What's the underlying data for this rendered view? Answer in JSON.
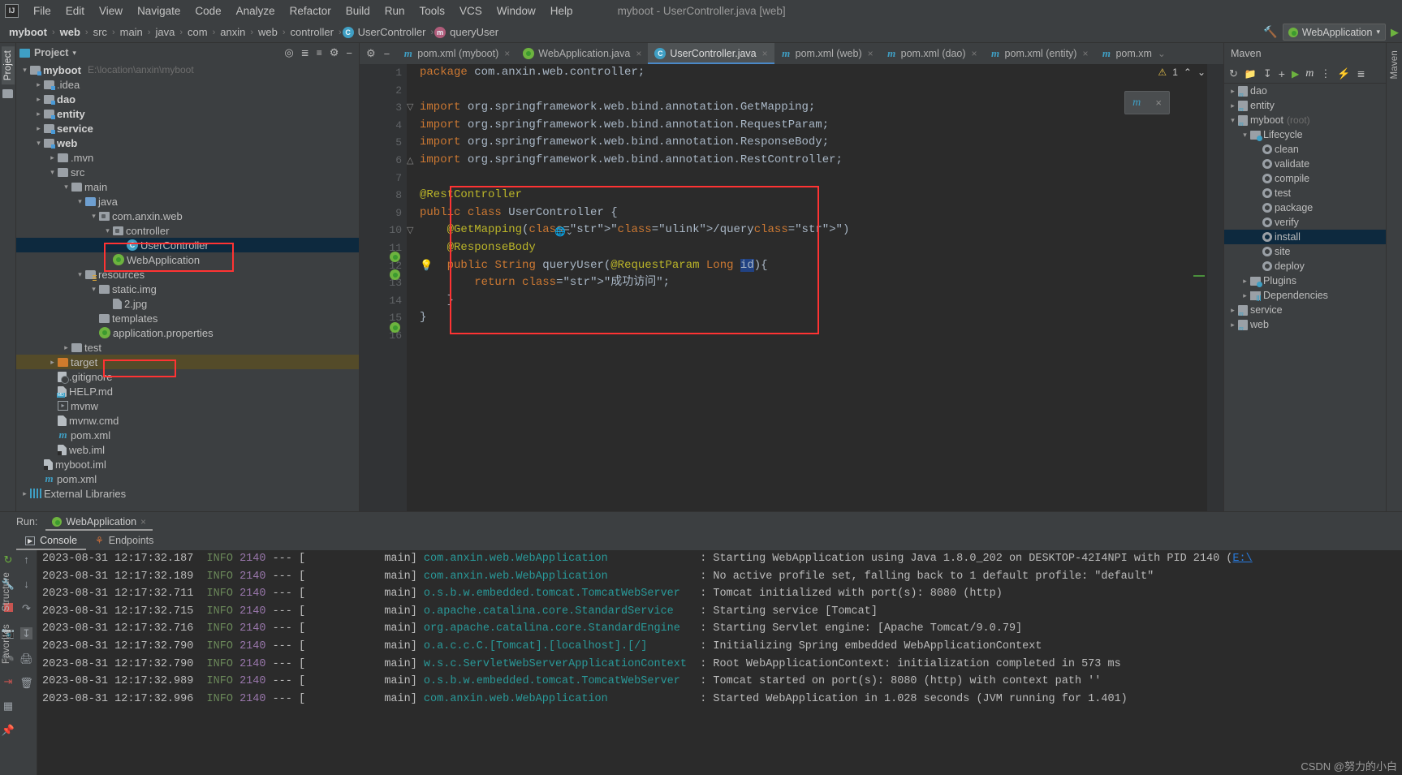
{
  "window": {
    "title": "myboot - UserController.java [web]",
    "logo": "IJ"
  },
  "menu": {
    "items": [
      "File",
      "Edit",
      "View",
      "Navigate",
      "Code",
      "Analyze",
      "Refactor",
      "Build",
      "Run",
      "Tools",
      "VCS",
      "Window",
      "Help"
    ]
  },
  "breadcrumb": {
    "items": [
      {
        "label": "myboot",
        "bold": true
      },
      {
        "label": "web",
        "bold": true
      },
      {
        "label": "src",
        "bold": false
      },
      {
        "label": "main",
        "bold": false
      },
      {
        "label": "java",
        "bold": false
      },
      {
        "label": "com",
        "bold": false
      },
      {
        "label": "anxin",
        "bold": false
      },
      {
        "label": "web",
        "bold": false
      },
      {
        "label": "controller",
        "bold": false
      },
      {
        "label": "UserController",
        "bold": false,
        "icon": "class-icon"
      },
      {
        "label": "queryUser",
        "bold": false,
        "icon": "method-icon"
      }
    ],
    "separator": "›"
  },
  "toolbar_right": {
    "run_config": "WebApplication",
    "dropdown_caret": "▾"
  },
  "project_panel": {
    "title": "Project",
    "caret": "▾",
    "tool_icons": [
      "locate-icon",
      "expand-all-icon",
      "collapse-all-icon",
      "gear-icon",
      "hide-icon"
    ],
    "tree": [
      {
        "label": "myboot",
        "path": "E:\\location\\anxin\\myboot",
        "depth": 0,
        "arrow": "open",
        "icon": "module-folder",
        "bold": true
      },
      {
        "label": ".idea",
        "depth": 1,
        "arrow": "closed",
        "icon": "module-folder"
      },
      {
        "label": "dao",
        "depth": 1,
        "arrow": "closed",
        "icon": "module-folder",
        "bold": true
      },
      {
        "label": "entity",
        "depth": 1,
        "arrow": "closed",
        "icon": "module-folder",
        "bold": true
      },
      {
        "label": "service",
        "depth": 1,
        "arrow": "closed",
        "icon": "module-folder",
        "bold": true
      },
      {
        "label": "web",
        "depth": 1,
        "arrow": "open",
        "icon": "module-folder",
        "bold": true
      },
      {
        "label": ".mvn",
        "depth": 2,
        "arrow": "closed",
        "icon": "folder"
      },
      {
        "label": "src",
        "depth": 2,
        "arrow": "open",
        "icon": "folder"
      },
      {
        "label": "main",
        "depth": 3,
        "arrow": "open",
        "icon": "folder"
      },
      {
        "label": "java",
        "depth": 4,
        "arrow": "open",
        "icon": "source-folder"
      },
      {
        "label": "com.anxin.web",
        "depth": 5,
        "arrow": "open",
        "icon": "package"
      },
      {
        "label": "controller",
        "depth": 6,
        "arrow": "open",
        "icon": "package"
      },
      {
        "label": "UserController",
        "depth": 7,
        "arrow": "none",
        "icon": "class",
        "selected": true
      },
      {
        "label": "WebApplication",
        "depth": 6,
        "arrow": "none",
        "icon": "spring-class"
      },
      {
        "label": "resources",
        "depth": 4,
        "arrow": "open",
        "icon": "resource-folder"
      },
      {
        "label": "static.img",
        "depth": 5,
        "arrow": "open",
        "icon": "folder"
      },
      {
        "label": "2.jpg",
        "depth": 6,
        "arrow": "none",
        "icon": "image-file"
      },
      {
        "label": "templates",
        "depth": 5,
        "arrow": "none",
        "icon": "folder"
      },
      {
        "label": "application.properties",
        "depth": 5,
        "arrow": "none",
        "icon": "spring-properties"
      },
      {
        "label": "test",
        "depth": 3,
        "arrow": "closed",
        "icon": "folder"
      },
      {
        "label": "target",
        "depth": 2,
        "arrow": "closed",
        "icon": "excluded-folder",
        "highlight": true
      },
      {
        "label": ".gitignore",
        "depth": 2,
        "arrow": "none",
        "icon": "gitignore-file"
      },
      {
        "label": "HELP.md",
        "depth": 2,
        "arrow": "none",
        "icon": "markdown-file"
      },
      {
        "label": "mvnw",
        "depth": 2,
        "arrow": "none",
        "icon": "script-file"
      },
      {
        "label": "mvnw.cmd",
        "depth": 2,
        "arrow": "none",
        "icon": "text-file"
      },
      {
        "label": "pom.xml",
        "depth": 2,
        "arrow": "none",
        "icon": "maven-file"
      },
      {
        "label": "web.iml",
        "depth": 2,
        "arrow": "none",
        "icon": "iml-file"
      },
      {
        "label": "myboot.iml",
        "depth": 1,
        "arrow": "none",
        "icon": "iml-file"
      },
      {
        "label": "pom.xml",
        "depth": 1,
        "arrow": "none",
        "icon": "maven-file"
      },
      {
        "label": "External Libraries",
        "depth": 0,
        "arrow": "closed",
        "icon": "library-icon"
      }
    ]
  },
  "editor": {
    "tabs": [
      {
        "label": "pom.xml (myboot)",
        "icon": "maven-file",
        "active": false,
        "closable": true
      },
      {
        "label": "WebApplication.java",
        "icon": "spring-class",
        "active": false,
        "closable": true
      },
      {
        "label": "UserController.java",
        "icon": "class",
        "active": true,
        "closable": true
      },
      {
        "label": "pom.xml (web)",
        "icon": "maven-file",
        "active": false,
        "closable": true
      },
      {
        "label": "pom.xml (dao)",
        "icon": "maven-file",
        "active": false,
        "closable": true
      },
      {
        "label": "pom.xml (entity)",
        "icon": "maven-file",
        "active": false,
        "closable": true
      },
      {
        "label": "pom.xm",
        "icon": "maven-file",
        "active": false,
        "closable": false,
        "overflow_caret": "⌄"
      }
    ],
    "inspection": {
      "warning_count": "1",
      "warning_glyph": "⚠",
      "up_caret": "⌃",
      "down_caret": "⌄"
    },
    "float_widget": {
      "icon": "maven-reimport-icon",
      "close": "×"
    },
    "line_numbers": [
      "1",
      "2",
      "3",
      "4",
      "5",
      "6",
      "7",
      "8",
      "9",
      "10",
      "11",
      "12",
      "13",
      "14",
      "15",
      "16"
    ],
    "code_lines": [
      "package com.anxin.web.controller;",
      "",
      "import org.springframework.web.bind.annotation.GetMapping;",
      "import org.springframework.web.bind.annotation.RequestParam;",
      "import org.springframework.web.bind.annotation.ResponseBody;",
      "import org.springframework.web.bind.annotation.RestController;",
      "",
      "@RestController",
      "public class UserController {",
      "    @GetMapping(\"/query\")",
      "    @ResponseBody",
      "    public String queryUser(@RequestParam Long id){",
      "        return \"成功访问\";",
      "    }",
      "}",
      ""
    ],
    "highlighted_token": "id",
    "mapping_path": "/query",
    "return_string": "\"成功访问\""
  },
  "maven": {
    "title": "Maven",
    "toolbar_icons": [
      "refresh-icon",
      "add-maven-project-icon",
      "download-sources-icon",
      "add-icon",
      "run-icon",
      "execute-maven-goal-icon",
      "toggle-skip-tests-icon",
      "toggle-offline-icon",
      "collapse-icon"
    ],
    "tree": [
      {
        "label": "dao",
        "depth": 0,
        "arrow": "closed",
        "icon": "maven-module"
      },
      {
        "label": "entity",
        "depth": 0,
        "arrow": "closed",
        "icon": "maven-module"
      },
      {
        "label": "myboot",
        "suffix": "(root)",
        "depth": 0,
        "arrow": "open",
        "icon": "maven-module"
      },
      {
        "label": "Lifecycle",
        "depth": 1,
        "arrow": "open",
        "icon": "lifecycle-folder"
      },
      {
        "label": "clean",
        "depth": 2,
        "arrow": "none",
        "icon": "goal"
      },
      {
        "label": "validate",
        "depth": 2,
        "arrow": "none",
        "icon": "goal"
      },
      {
        "label": "compile",
        "depth": 2,
        "arrow": "none",
        "icon": "goal"
      },
      {
        "label": "test",
        "depth": 2,
        "arrow": "none",
        "icon": "goal"
      },
      {
        "label": "package",
        "depth": 2,
        "arrow": "none",
        "icon": "goal"
      },
      {
        "label": "verify",
        "depth": 2,
        "arrow": "none",
        "icon": "goal"
      },
      {
        "label": "install",
        "depth": 2,
        "arrow": "none",
        "icon": "goal",
        "selected": true
      },
      {
        "label": "site",
        "depth": 2,
        "arrow": "none",
        "icon": "goal"
      },
      {
        "label": "deploy",
        "depth": 2,
        "arrow": "none",
        "icon": "goal"
      },
      {
        "label": "Plugins",
        "depth": 1,
        "arrow": "closed",
        "icon": "plugins-folder"
      },
      {
        "label": "Dependencies",
        "depth": 1,
        "arrow": "closed",
        "icon": "dependencies-folder"
      },
      {
        "label": "service",
        "depth": 0,
        "arrow": "closed",
        "icon": "maven-module"
      },
      {
        "label": "web",
        "depth": 0,
        "arrow": "closed",
        "icon": "maven-module"
      }
    ]
  },
  "run_panel": {
    "run_label": "Run:",
    "config_tab": "WebApplication",
    "sub_tabs": [
      {
        "label": "Console",
        "icon": "console-icon",
        "active": true
      },
      {
        "label": "Endpoints",
        "icon": "endpoints-icon",
        "active": false
      }
    ],
    "side_icons": [
      "rerun-icon",
      "settings-icon",
      "stop-icon",
      "camera-icon",
      "debug-icon",
      "export-icon",
      "layout-icon",
      "pin-icon"
    ],
    "console_icons": [
      "scroll-up-icon",
      "scroll-down-icon",
      "soft-wrap-icon",
      "scroll-to-end-icon",
      "print-icon",
      "delete-icon"
    ],
    "console_lines": [
      {
        "ts": "2023-08-31 12:17:32.187",
        "level": "INFO",
        "pid": "2140",
        "thread": "main",
        "logger": "com.anxin.web.WebApplication",
        "msg": ": Starting WebApplication using Java 1.8.0_202 on DESKTOP-42I4NPI with PID 2140 (",
        "link": "E:\\"
      },
      {
        "ts": "2023-08-31 12:17:32.189",
        "level": "INFO",
        "pid": "2140",
        "thread": "main",
        "logger": "com.anxin.web.WebApplication",
        "msg": ": No active profile set, falling back to 1 default profile: \"default\"",
        "link": ""
      },
      {
        "ts": "2023-08-31 12:17:32.711",
        "level": "INFO",
        "pid": "2140",
        "thread": "main",
        "logger": "o.s.b.w.embedded.tomcat.TomcatWebServer",
        "msg": ": Tomcat initialized with port(s): 8080 (http)",
        "link": ""
      },
      {
        "ts": "2023-08-31 12:17:32.715",
        "level": "INFO",
        "pid": "2140",
        "thread": "main",
        "logger": "o.apache.catalina.core.StandardService",
        "msg": ": Starting service [Tomcat]",
        "link": ""
      },
      {
        "ts": "2023-08-31 12:17:32.716",
        "level": "INFO",
        "pid": "2140",
        "thread": "main",
        "logger": "org.apache.catalina.core.StandardEngine",
        "msg": ": Starting Servlet engine: [Apache Tomcat/9.0.79]",
        "link": ""
      },
      {
        "ts": "2023-08-31 12:17:32.790",
        "level": "INFO",
        "pid": "2140",
        "thread": "main",
        "logger": "o.a.c.c.C.[Tomcat].[localhost].[/]",
        "msg": ": Initializing Spring embedded WebApplicationContext",
        "link": ""
      },
      {
        "ts": "2023-08-31 12:17:32.790",
        "level": "INFO",
        "pid": "2140",
        "thread": "main",
        "logger": "w.s.c.ServletWebServerApplicationContext",
        "msg": ": Root WebApplicationContext: initialization completed in 573 ms",
        "link": ""
      },
      {
        "ts": "2023-08-31 12:17:32.989",
        "level": "INFO",
        "pid": "2140",
        "thread": "main",
        "logger": "o.s.b.w.embedded.tomcat.TomcatWebServer",
        "msg": ": Tomcat started on port(s): 8080 (http) with context path ''",
        "link": ""
      },
      {
        "ts": "2023-08-31 12:17:32.996",
        "level": "INFO",
        "pid": "2140",
        "thread": "main",
        "logger": "com.anxin.web.WebApplication",
        "msg": ": Started WebApplication in 1.028 seconds (JVM running for 1.401)",
        "link": ""
      }
    ]
  },
  "left_strip": {
    "tabs": [
      "Project"
    ]
  },
  "bottom_left_strip": {
    "tabs": [
      "Structure",
      "Favorites"
    ]
  },
  "watermark": "CSDN @努力的小白",
  "colors": {
    "accent": "#4a88c7",
    "selection": "#0d293e",
    "highlight_box": "#ff3333",
    "spring_green": "#6db33f"
  }
}
